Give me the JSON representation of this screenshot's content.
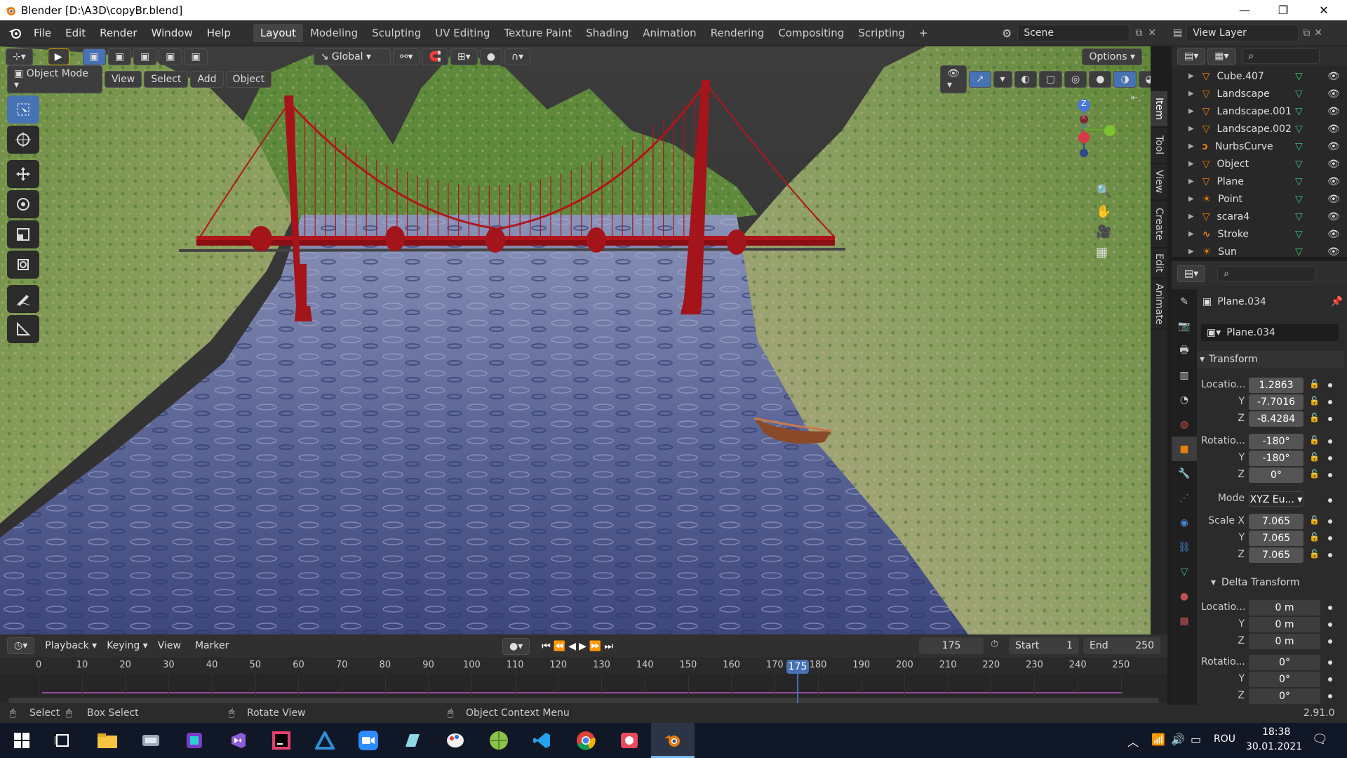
{
  "window": {
    "title": "Blender [D:\\A3D\\copyBr.blend]",
    "minimize": "—",
    "restore": "❐",
    "close": "✕"
  },
  "menubar": {
    "menus": [
      "File",
      "Edit",
      "Render",
      "Window",
      "Help"
    ],
    "workspaces": [
      "Layout",
      "Modeling",
      "Sculpting",
      "UV Editing",
      "Texture Paint",
      "Shading",
      "Animation",
      "Rendering",
      "Compositing",
      "Scripting"
    ],
    "active_workspace": "Layout",
    "add_tab": "+",
    "scene": "Scene",
    "view_layer": "View Layer"
  },
  "viewport_header": {
    "transform_orientation": "Global",
    "options": "Options"
  },
  "viewport_header2": {
    "mode": "Object Mode",
    "menus": [
      "View",
      "Select",
      "Add",
      "Object"
    ]
  },
  "navigation_gizmo": {
    "z": "Z",
    "y": "Y",
    "x": "X"
  },
  "sidebar_tabs": [
    "Item",
    "Tool",
    "View",
    "Create",
    "Edit",
    "Animate"
  ],
  "outliner": {
    "items": [
      {
        "name": "Cube.407",
        "icon": "mesh-icon"
      },
      {
        "name": "Landscape",
        "icon": "mesh-icon"
      },
      {
        "name": "Landscape.001",
        "icon": "mesh-icon"
      },
      {
        "name": "Landscape.002",
        "icon": "mesh-icon"
      },
      {
        "name": "NurbsCurve",
        "icon": "curve-icon"
      },
      {
        "name": "Object",
        "icon": "mesh-icon"
      },
      {
        "name": "Plane",
        "icon": "mesh-icon"
      },
      {
        "name": "Point",
        "icon": "light-icon"
      },
      {
        "name": "scara4",
        "icon": "mesh-icon"
      },
      {
        "name": "Stroke",
        "icon": "grease-pencil-icon"
      },
      {
        "name": "Sun",
        "icon": "light-icon"
      }
    ]
  },
  "properties": {
    "object_name": "Plane.034",
    "object_field": "Plane.034",
    "transform_header": "Transform",
    "location_label": "Locatio...",
    "location": [
      "1.2863",
      "-7.7016",
      "-8.4284"
    ],
    "rotation_label": "Rotatio...",
    "rotation": [
      "-180°",
      "-180°",
      "0°"
    ],
    "mode_label": "Mode",
    "mode_value": "XYZ Eu...",
    "scale_label": "Scale X",
    "scale": [
      "7.065",
      "7.065",
      "7.065"
    ],
    "axis_y": "Y",
    "axis_z": "Z",
    "delta_header": "Delta Transform",
    "delta_location": [
      "0 m",
      "0 m",
      "0 m"
    ],
    "delta_rotation": [
      "0°",
      "0°",
      "0°"
    ]
  },
  "timeline": {
    "menus": [
      "Playback",
      "Keying",
      "View",
      "Marker"
    ],
    "current_frame": "175",
    "start_label": "Start",
    "start": "1",
    "end_label": "End",
    "end": "250",
    "ticks": [
      "0",
      "10",
      "20",
      "30",
      "40",
      "50",
      "60",
      "70",
      "80",
      "90",
      "100",
      "110",
      "120",
      "130",
      "140",
      "150",
      "160",
      "170",
      "180",
      "190",
      "200",
      "210",
      "220",
      "230",
      "240",
      "250"
    ],
    "playhead": "175"
  },
  "statusbar": {
    "select": "Select",
    "box_select": "Box Select",
    "rotate_view": "Rotate View",
    "context_menu": "Object Context Menu",
    "version": "2.91.0"
  },
  "taskbar": {
    "language": "ROU",
    "time": "18:38",
    "date": "30.01.2021",
    "apps": [
      "start-icon",
      "task-view-icon",
      "file-explorer-icon",
      "app-icon",
      "app-icon",
      "visual-studio-icon",
      "jetbrains-icon",
      "app-icon",
      "zoom-icon",
      "app-icon",
      "paint-icon",
      "app-icon",
      "vscode-icon",
      "chrome-icon",
      "app-icon",
      "blender-icon"
    ]
  },
  "colors": {
    "accent": "#4772b3",
    "playhead": "#4772b3",
    "bridge": "#b0151c",
    "orange": "#e87d0d"
  }
}
